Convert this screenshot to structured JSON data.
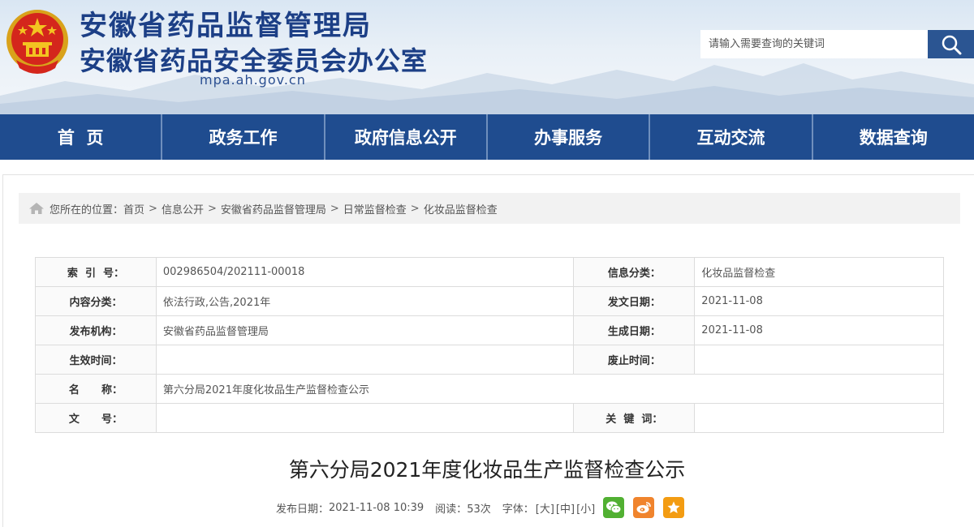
{
  "header": {
    "title_line1": "安徽省药品监督管理局",
    "title_line2": "安徽省药品安全委员会办公室",
    "domain": "mpa.ah.gov.cn",
    "search_placeholder": "请输入需要查询的关键词"
  },
  "nav": {
    "items": [
      {
        "label": "首  页"
      },
      {
        "label": "政务工作"
      },
      {
        "label": "政府信息公开"
      },
      {
        "label": "办事服务"
      },
      {
        "label": "互动交流"
      },
      {
        "label": "数据查询"
      }
    ]
  },
  "breadcrumb": {
    "prefix": "您所在的位置：",
    "items": [
      "首页",
      "信息公开",
      "安徽省药品监督管理局",
      "日常监督检查",
      "化妆品监督检查"
    ],
    "separator": ">"
  },
  "meta_table": {
    "index_label": "索  引  号：",
    "index_value": "002986504/202111-00018",
    "category_label": "信息分类：",
    "category_value": "化妆品监督检查",
    "content_type_label": "内容分类：",
    "content_type_value": "依法行政,公告,2021年",
    "issue_date_label": "发文日期：",
    "issue_date_value": "2021-11-08",
    "publisher_label": "发布机构：",
    "publisher_value": "安徽省药品监督管理局",
    "created_date_label": "生成日期：",
    "created_date_value": "2021-11-08",
    "effective_label": "生效时间：",
    "effective_value": "",
    "expire_label": "废止时间：",
    "expire_value": "",
    "name_label": "名      称：",
    "name_value": "第六分局2021年度化妆品生产监督检查公示",
    "docno_label": "文      号：",
    "docno_value": "",
    "keywords_label": "关  键  词：",
    "keywords_value": ""
  },
  "article": {
    "title": "第六分局2021年度化妆品生产监督检查公示",
    "publish_label": "发布日期：",
    "publish_value": "2021-11-08 10:39",
    "views_label": "阅读：",
    "views_value": "53次",
    "font_label": "字体：",
    "font_large": "[大]",
    "font_medium": "[中]",
    "font_small": "[小]"
  },
  "colors": {
    "brand_blue": "#1f4c8f",
    "title_blue": "#1c3f86",
    "wechat_green": "#51b032",
    "weibo_orange": "#f0842d",
    "qzone_yellow": "#f39c12"
  },
  "icons": [
    "national-emblem-icon",
    "search-icon",
    "home-icon",
    "wechat-icon",
    "weibo-icon",
    "star-icon"
  ]
}
